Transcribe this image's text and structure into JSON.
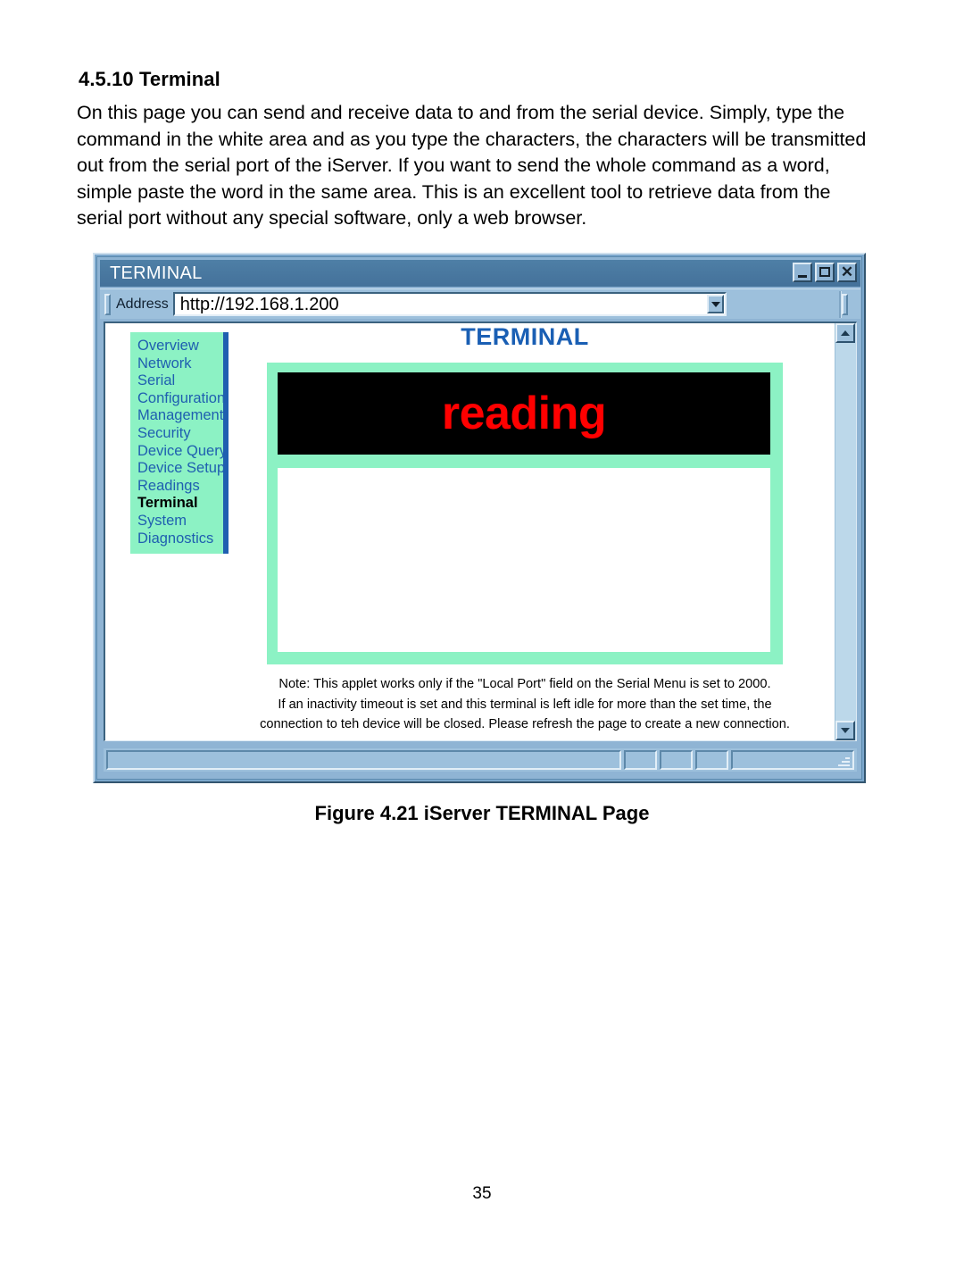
{
  "document": {
    "section_number_title": "4.5.10 Terminal",
    "paragraph": "On this page you can send and receive data to and from the serial device. Simply, type the command in the white area and as you type the characters, the characters will be transmitted out from the serial port of the iServer. If you want to send the whole command as a word, simple paste the word in the same area. This is an excellent tool to retrieve data from the serial port without any special software, only a web browser.",
    "figure_caption": "Figure 4.21  iServer TERMINAL Page",
    "page_number": "35"
  },
  "browser": {
    "title": "TERMINAL",
    "window_buttons": {
      "minimize": "minimize-icon",
      "maximize": "maximize-icon",
      "close": "✕"
    },
    "address": {
      "label": "Address",
      "value": "http://192.168.1.200",
      "placeholder": "http://",
      "dropdown_icon": "chevron-down-icon"
    },
    "scrollbar": {
      "up_icon": "arrow-up-icon",
      "down_icon": "arrow-down-icon"
    },
    "status_bar": {
      "panel1": "",
      "panel2": "",
      "panel3": "",
      "panel4": "",
      "panel5": ""
    }
  },
  "webpage": {
    "nav": {
      "items": [
        {
          "label": "Overview",
          "active": false
        },
        {
          "label": "Network",
          "active": false
        },
        {
          "label": "Serial",
          "active": false
        },
        {
          "label": "Configuration",
          "active": false
        },
        {
          "label": "Management",
          "active": false
        },
        {
          "label": "Security",
          "active": false
        },
        {
          "label": "Device Query",
          "active": false
        },
        {
          "label": "Device Setup",
          "active": false
        },
        {
          "label": "Readings",
          "active": false
        },
        {
          "label": "Terminal",
          "active": true
        },
        {
          "label": "System",
          "active": false
        },
        {
          "label": "Diagnostics",
          "active": false
        }
      ]
    },
    "heading": "TERMINAL",
    "applet": {
      "output_text": "reading",
      "input_text": ""
    },
    "note_lines": [
      "Note: This applet works only if the \"Local Port\" field on the Serial Menu is set to 2000.",
      "If an inactivity timeout is set and this terminal is left idle for more than the set time, the",
      "connection to teh device will be closed. Please refresh the page to create a new connection."
    ]
  },
  "colors": {
    "nav_bg": "#8cf2c4",
    "nav_link": "#1f5fb0",
    "nav_active": "#000000",
    "nav_edge": "#1f5fb0",
    "heading": "#1a5fb4",
    "terminal_bg": "#000000",
    "terminal_text": "#ff0000",
    "titlebar": "#44719a",
    "window_chrome": "#9dc0dc"
  }
}
